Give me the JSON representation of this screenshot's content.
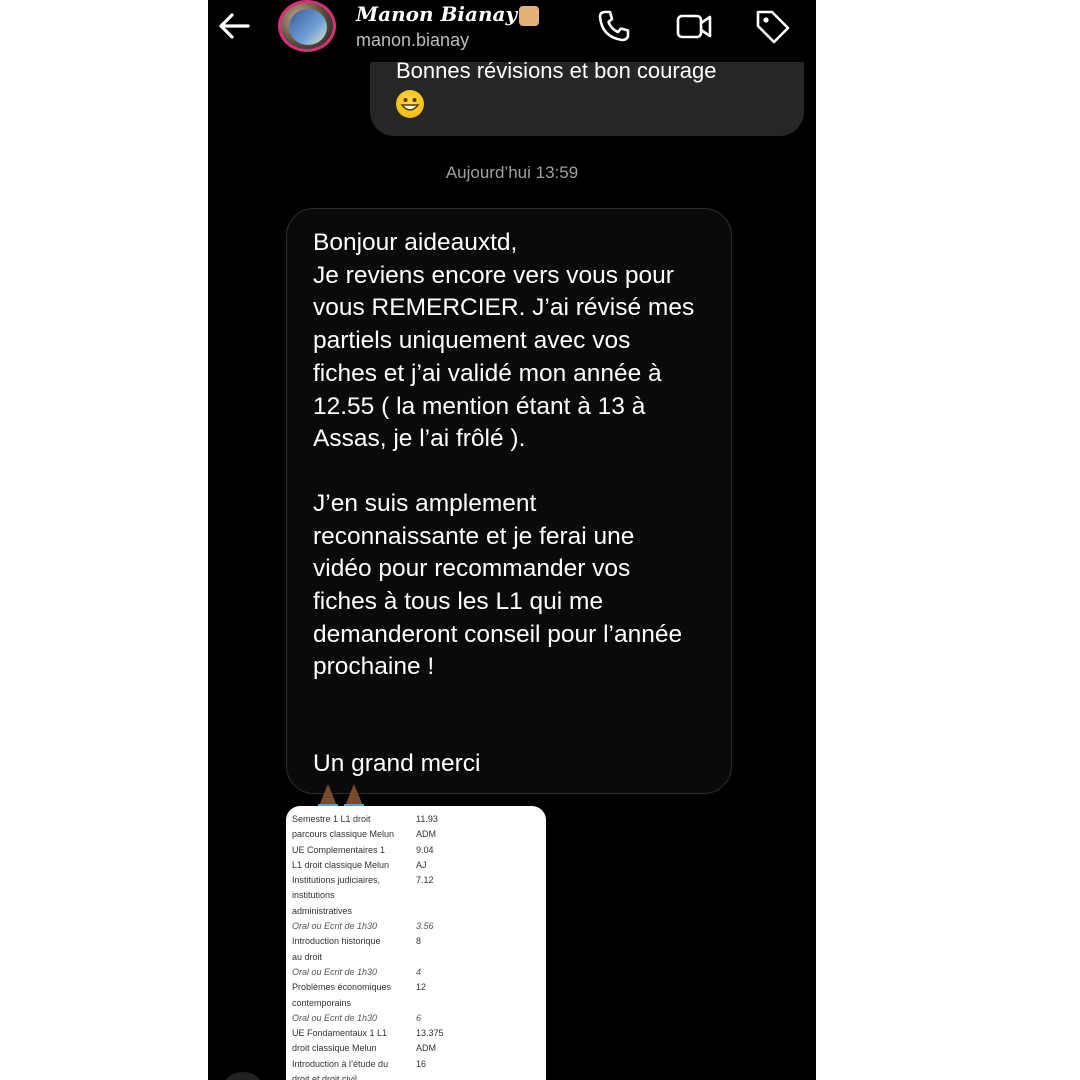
{
  "header": {
    "name": "Manon Bianay",
    "username": "manon.bianay"
  },
  "prev_message": {
    "text": "Bonnes révisions et bon courage"
  },
  "timestamp": "Aujourd’hui 13:59",
  "message": {
    "para1": "Bonjour aideauxtd,\nJe reviens encore vers vous pour\nvous REMERCIER. J’ai révisé mes\npartiels uniquement avec vos\nfiches et j’ai validé mon année à\n12.55 ( la mention étant à 13 à\nAssas, je l’ai frôlé ).",
    "para2": "J’en suis amplement\nreconnaissante et je ferai une\nvidéo pour recommander vos\nfiches à tous les L1 qui me\ndemanderont conseil pour l’année\nprochaine !",
    "closing": "Un grand merci"
  },
  "grades": {
    "rows": [
      {
        "label": "Semestre 1 L1 droit",
        "value": "11.93",
        "italic": false
      },
      {
        "label": "parcours classique Melun",
        "value": "ADM",
        "italic": false
      },
      {
        "label": "UE Complementaires 1",
        "value": "9.04",
        "italic": false
      },
      {
        "label": "L1 droit classique Melun",
        "value": "AJ",
        "italic": false
      },
      {
        "label": "Institutions judiciaires,",
        "value": "7.12",
        "italic": false
      },
      {
        "label": "institutions",
        "value": "",
        "italic": false
      },
      {
        "label": "administratives",
        "value": "",
        "italic": false
      },
      {
        "label": "Oral ou Ecrit de 1h30",
        "value": "3.56",
        "italic": true
      },
      {
        "label": "Introduction historique",
        "value": "8",
        "italic": false
      },
      {
        "label": "au droit",
        "value": "",
        "italic": false
      },
      {
        "label": "Oral ou Ecrit de 1h30",
        "value": "4",
        "italic": true
      },
      {
        "label": "Problèmes économiques",
        "value": "12",
        "italic": false
      },
      {
        "label": "contemporains",
        "value": "",
        "italic": false
      },
      {
        "label": "Oral ou Ecrit de 1h30",
        "value": "6",
        "italic": true
      },
      {
        "label": "UE Fondamentaux 1 L1",
        "value": "13.375",
        "italic": false
      },
      {
        "label": "droit classique Melun",
        "value": "ADM",
        "italic": false
      },
      {
        "label": "Introduction à l’étude du",
        "value": "16",
        "italic": false
      },
      {
        "label": "droit et droit civil",
        "value": "",
        "italic": false
      }
    ]
  },
  "icons": {
    "back": "arrow-left-icon",
    "call": "phone-icon",
    "video": "video-camera-icon",
    "tag": "tag-icon",
    "emoji_smile": "grinning-face-emoji",
    "emoji_pray": "folded-hands-emoji"
  },
  "colors": {
    "background": "#000000",
    "bubble_received": "#0a0a0a",
    "bubble_sent": "#262626",
    "text": "#ffffff",
    "avatar_ring": "#d6307a"
  }
}
